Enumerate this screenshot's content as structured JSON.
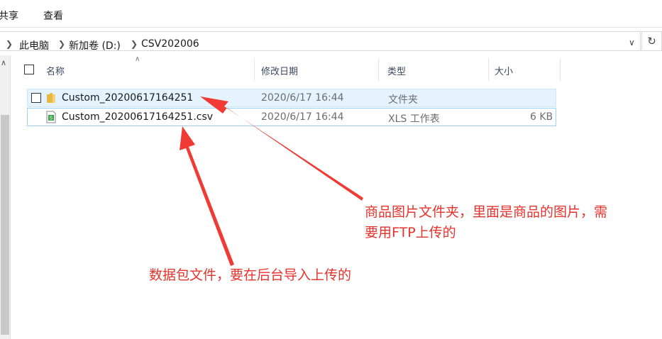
{
  "ribbon": {
    "tabs": [
      "共享",
      "查看"
    ]
  },
  "address": {
    "crumbs": [
      "此电脑",
      "新加卷 (D:)",
      "CSV202006"
    ]
  },
  "columns": {
    "name": "名称",
    "modified": "修改日期",
    "type": "类型",
    "size": "大小"
  },
  "files": [
    {
      "name": "Custom_20200617164251",
      "modified": "2020/6/17 16:44",
      "type": "文件夹",
      "size": "",
      "icon": "folder-icon"
    },
    {
      "name": "Custom_20200617164251.csv",
      "modified": "2020/6/17 16:44",
      "type": "XLS 工作表",
      "size": "6 KB",
      "icon": "csv-file-icon"
    }
  ],
  "annotations": {
    "folder_note_line1": "商品图片文件夹，里面是商品的图片，需",
    "folder_note_line2": "要用FTP上传的",
    "csv_note": "数据包文件，要在后台导入上传的"
  },
  "colors": {
    "annotation": "#e8322c",
    "selection": "#e5f3ff",
    "selection_border": "#cce8ff",
    "focus_border": "#99d1ff",
    "folder": "#e8b840",
    "csv": "#3aa046"
  }
}
